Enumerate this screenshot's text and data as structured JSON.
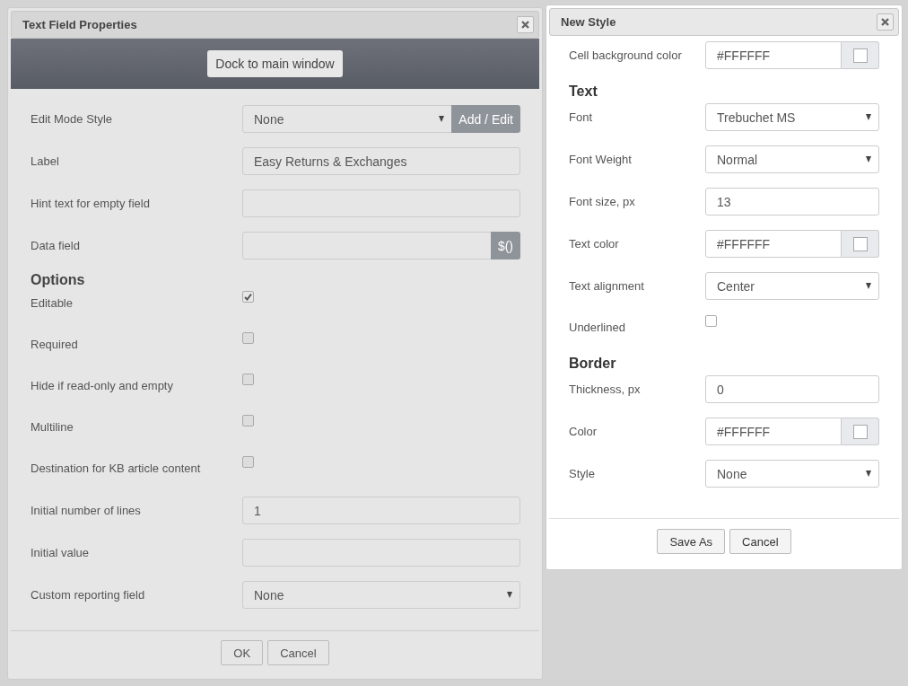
{
  "text_field_properties": {
    "title": "Text Field Properties",
    "dock_button": "Dock to main window",
    "fields": [
      {
        "kind": "select",
        "label": "Edit Mode Style",
        "value": "None",
        "button": "Add / Edit"
      },
      {
        "kind": "text",
        "label": "Label",
        "value": "Easy Returns & Exchanges"
      },
      {
        "kind": "text",
        "label": "Hint text for empty field"
      },
      {
        "kind": "text",
        "label": "Data field",
        "button": "$()"
      },
      {
        "kind": "heading",
        "label": "Options"
      },
      {
        "kind": "checkbox",
        "label": "Editable",
        "checked": true
      },
      {
        "kind": "checkbox",
        "label": "Required",
        "checked": false
      },
      {
        "kind": "checkbox",
        "label": "Hide if read-only and empty",
        "checked": false
      },
      {
        "kind": "checkbox",
        "label": "Multiline",
        "checked": false
      },
      {
        "kind": "checkbox",
        "label": "Destination for KB article content",
        "checked": false
      },
      {
        "kind": "text",
        "label": "Initial number of lines",
        "value": "1"
      },
      {
        "kind": "text",
        "label": "Initial value"
      },
      {
        "kind": "select",
        "label": "Custom reporting field",
        "value": "None"
      }
    ],
    "buttons": [
      "OK",
      "Cancel"
    ]
  },
  "new_style": {
    "title": "New Style",
    "fields": [
      {
        "kind": "color",
        "label": "Cell background color",
        "value": "#FFFFFF",
        "color": "#ffffff"
      },
      {
        "kind": "heading",
        "label": "Text"
      },
      {
        "kind": "select",
        "label": "Font",
        "value": "Trebuchet MS"
      },
      {
        "kind": "select",
        "label": "Font Weight",
        "value": "Normal"
      },
      {
        "kind": "text",
        "label": "Font size, px",
        "value": "13"
      },
      {
        "kind": "color",
        "label": "Text color",
        "value": "#FFFFFF",
        "color": "#ffffff"
      },
      {
        "kind": "select",
        "label": "Text alignment",
        "value": "Center"
      },
      {
        "kind": "checkbox",
        "label": "Underlined",
        "checked": false
      },
      {
        "kind": "heading",
        "label": "Border"
      },
      {
        "kind": "text",
        "label": "Thickness, px",
        "value": "0"
      },
      {
        "kind": "color",
        "label": "Color",
        "value": "#FFFFFF",
        "color": "#ffffff"
      },
      {
        "kind": "select",
        "label": "Style",
        "value": "None"
      }
    ],
    "buttons": [
      "Save As",
      "Cancel"
    ]
  }
}
